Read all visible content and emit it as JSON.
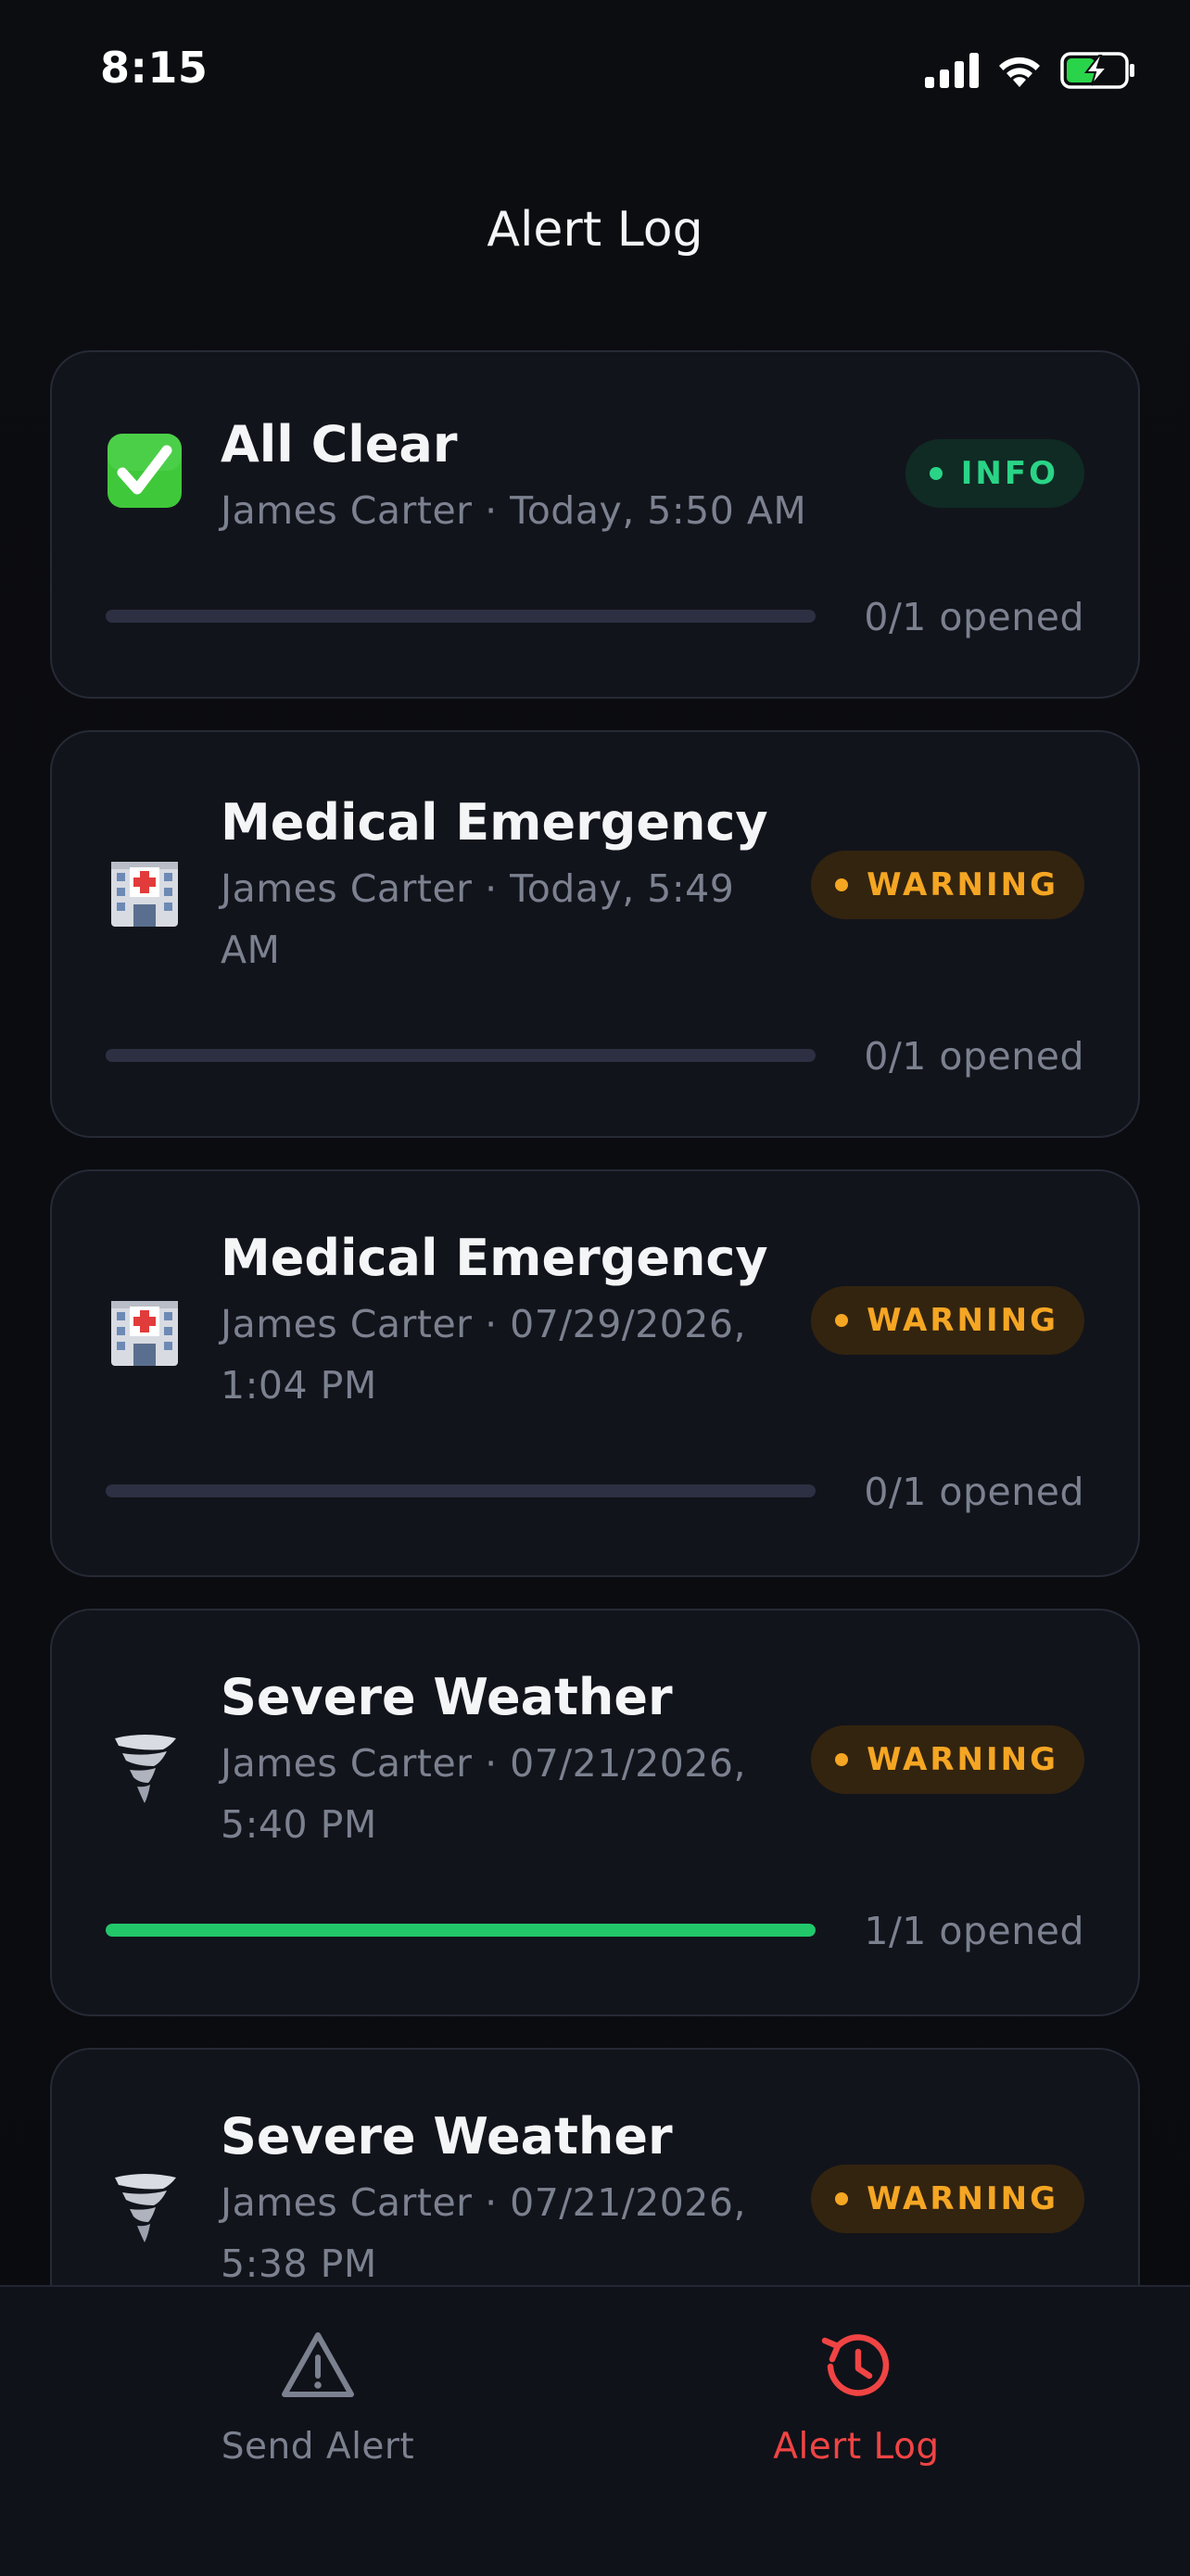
{
  "status_bar": {
    "time": "8:15"
  },
  "header": {
    "title": "Alert Log"
  },
  "alerts": [
    {
      "icon": "check-mark-button-icon",
      "title": "All Clear",
      "meta": "James Carter · Today, 5:50 AM",
      "badge": "INFO",
      "opened": "0/1 opened",
      "opened_fraction": 0
    },
    {
      "icon": "hospital-icon",
      "title": "Medical Emergency",
      "meta_line1": "James Carter · Today, 5:49",
      "meta_line2": "AM",
      "badge": "WARNING",
      "opened": "0/1 opened",
      "opened_fraction": 0
    },
    {
      "icon": "hospital-icon",
      "title": "Medical Emergency",
      "meta_line1": "James Carter · 07/29/2026,",
      "meta_line2": "1:04 PM",
      "badge": "WARNING",
      "opened": "0/1 opened",
      "opened_fraction": 0
    },
    {
      "icon": "tornado-icon",
      "title": "Severe Weather",
      "meta_line1": "James Carter · 07/21/2026,",
      "meta_line2": "5:40 PM",
      "badge": "WARNING",
      "opened": "1/1 opened",
      "opened_fraction": 1
    },
    {
      "icon": "tornado-icon",
      "title": "Severe Weather",
      "meta_line1": "James Carter · 07/21/2026,",
      "meta_line2": "5:38 PM",
      "badge": "WARNING"
    }
  ],
  "tabs": [
    {
      "label": "Send Alert",
      "icon": "warning-triangle-icon",
      "active": false
    },
    {
      "label": "Alert Log",
      "icon": "history-clock-icon",
      "active": true
    }
  ],
  "colors": {
    "background": "#0b0c10",
    "card": "#12141b",
    "info": "#2ad486",
    "warning": "#f5a623",
    "progress_done": "#22c76a",
    "active_tab": "#f04444"
  }
}
